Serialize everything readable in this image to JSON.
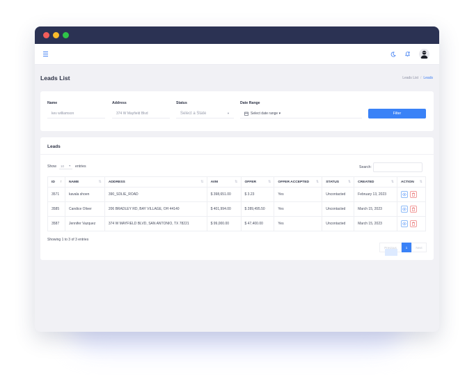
{
  "page": {
    "title": "Leads List",
    "breadcrumb": [
      "Leads List",
      "Leads"
    ]
  },
  "filters": {
    "name_label": "Name",
    "name_value": "kev williamson",
    "address_label": "Address",
    "address_value": "374 W Mayfield Blvd",
    "status_label": "Status",
    "status_placeholder": "Select a State",
    "date_label": "Date Range",
    "date_placeholder": "Select date range ▾",
    "filter_button": "Filter"
  },
  "leads": {
    "title": "Leads",
    "show_label": "Show",
    "entries_value": "10",
    "entries_label": "entries",
    "search_label": "Search:",
    "columns": [
      "ID",
      "NAME",
      "ADDRESS",
      "AVM",
      "OFFER",
      "OFFER ACCEPTED",
      "STATUS",
      "CREATED",
      "ACTION"
    ],
    "rows": [
      {
        "id": "3571",
        "name": "kavala shoen",
        "address": "390_SDLIE_ROAD",
        "avm": "$ 398,651.00",
        "offer": "$ 3.23",
        "accepted": "Yes",
        "status": "Uncontacted",
        "created": "February 13, 2023"
      },
      {
        "id": "3585",
        "name": "Candice Oliver",
        "address": "206 BRADLEY RD, BAY VILLAGE, OH 44140",
        "avm": "$ 401,994.00",
        "offer": "$ 289,495.50",
        "accepted": "Yes",
        "status": "Uncontacted",
        "created": "March 15, 2023"
      },
      {
        "id": "3587",
        "name": "Jennifer Vazquez",
        "address": "374 W MAYFIELD BLVD, SAN ANTONIO, TX 78221",
        "avm": "$ 99,000.00",
        "offer": "$ 47,400.00",
        "accepted": "Yes",
        "status": "Uncontacted",
        "created": "March 15, 2023"
      }
    ],
    "showing": "Showing 1 to 3 of 3 entries",
    "pager": {
      "prev": "Previous",
      "current": "1",
      "next": "Next"
    }
  },
  "colors": {
    "accent": "#3a82f7",
    "titlebar": "#2b3253",
    "danger": "#e25454"
  }
}
